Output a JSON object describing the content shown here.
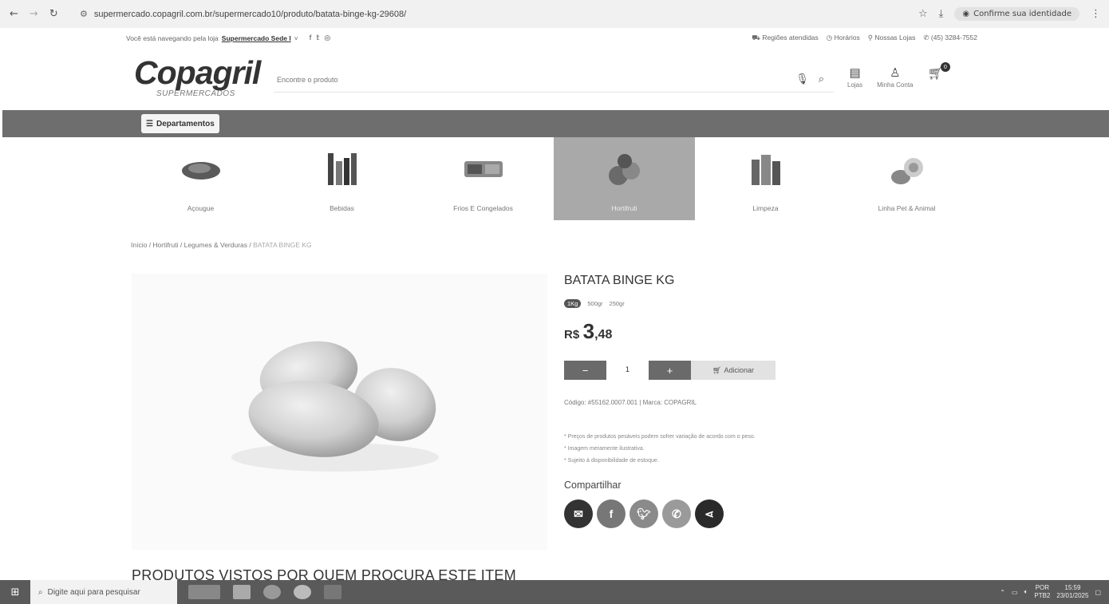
{
  "browser": {
    "url": "supermercado.copagril.com.br/supermercado10/produto/batata-binge-kg-29608/",
    "identity_label": "Confirme sua identidade"
  },
  "topbar": {
    "store_prefix": "Você está navegando pela loja",
    "store_name": "Supermercado Sede I",
    "links": [
      "Regiões atendidas",
      "Horários",
      "Nossas Lojas",
      "(45) 3284-7552"
    ]
  },
  "header": {
    "logo_name": "Copagril",
    "logo_sub": "SUPERMERCADOS",
    "search_placeholder": "Encontre o produto",
    "stores_label": "Lojas",
    "account_label": "Minha Conta",
    "cart_count": "0"
  },
  "nav": {
    "departments_label": "Departamentos"
  },
  "categories": [
    {
      "label": "Açougue",
      "active": false
    },
    {
      "label": "Bebidas",
      "active": false
    },
    {
      "label": "Frios E Congelados",
      "active": false
    },
    {
      "label": "Hortifruti",
      "active": true
    },
    {
      "label": "Limpeza",
      "active": false
    },
    {
      "label": "Linha Pet & Animal",
      "active": false
    }
  ],
  "breadcrumb": {
    "items": [
      "Início",
      "Hortifruti",
      "Legumes & Verduras"
    ],
    "current": "BATATA BINGE KG"
  },
  "product": {
    "title": "BATATA BINGE KG",
    "variants": [
      "1Kg",
      "500gr",
      "250gr"
    ],
    "selected_variant": "1Kg",
    "currency": "R$",
    "price_int": "3",
    "price_dec": ",48",
    "quantity": "1",
    "minus_label": "−",
    "plus_label": "+",
    "add_label": "Adicionar",
    "code_line": "Código: #55162.0007.001 | Marca: COPAGRIL",
    "notes": [
      "* Preços de produtos pesáveis podem sofrer variação de acordo com o peso.",
      "* Imagem meramente ilustrativa.",
      "* Sujeito à disponibilidade de estoque."
    ],
    "share_title": "Compartilhar"
  },
  "section": {
    "seen_title": "PRODUTOS VISTOS POR QUEM PROCURA ESTE ITEM"
  },
  "taskbar": {
    "search_placeholder": "Digite aqui para pesquisar",
    "lang": "POR",
    "lang_sub": "PTB2",
    "time": "15:59",
    "date": "23/01/2025"
  },
  "colors": {
    "dept_bar": "#6e6e6e",
    "active_category": "#a9a9a9",
    "qty_button": "#6a6a6a",
    "share_email": "#333333",
    "share_facebook": "#777777",
    "share_twitter": "#8a8a8a",
    "share_whatsapp": "#9a9a9a",
    "share_other": "#2a2a2a"
  }
}
